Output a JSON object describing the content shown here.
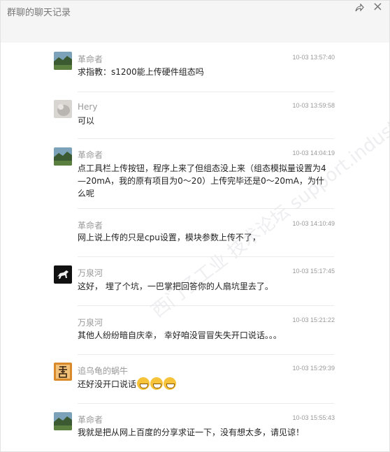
{
  "window": {
    "title": "群聊的聊天记录",
    "close_symbol": "×"
  },
  "watermark": "西门子工业 技术论坛 support.industry.siemens.com",
  "messages": [
    {
      "name": "革命者",
      "time": "10-03 13:57:40",
      "text": "求指教：s1200能上传硬件组态吗",
      "avatar": "landscape"
    },
    {
      "name": "Hery",
      "time": "10-03 13:59:58",
      "text": "可以",
      "avatar": "gray-pet"
    },
    {
      "name": "革命者",
      "time": "10-03 14:04:19",
      "text": "点工具栏上传按钮，程序上来了但组态没上来（组态模拟量设置为4—20mA，我的原有项目为0～20）上传完毕还是0～20mA，为什么呢",
      "avatar": "landscape"
    },
    {
      "name": "革命者",
      "time": "10-03 14:10:49",
      "text": "网上说上传的只是cpu设置，模块参数上传不了，",
      "avatar": ""
    },
    {
      "name": "万泉河",
      "time": "10-03 15:17:45",
      "text": "这好， 埋了个坑，一巴掌把回答你的人扇坑里去了。",
      "avatar": "horse"
    },
    {
      "name": "万泉河",
      "time": "10-03 15:21:22",
      "text": "其他人纷纷暗自庆幸， 幸好咱没冒冒失失开口说话。。。",
      "avatar": ""
    },
    {
      "name": "追乌龟的蜗牛",
      "time": "10-03 15:29:39",
      "text": "还好没开口说话",
      "avatar": "calligraphy",
      "emoji_count": 3
    },
    {
      "name": "革命者",
      "time": "10-03 15:55:43",
      "text": "我就是把从网上百度的分享求证一下，没有想太多，请见谅！",
      "avatar": "landscape"
    }
  ]
}
